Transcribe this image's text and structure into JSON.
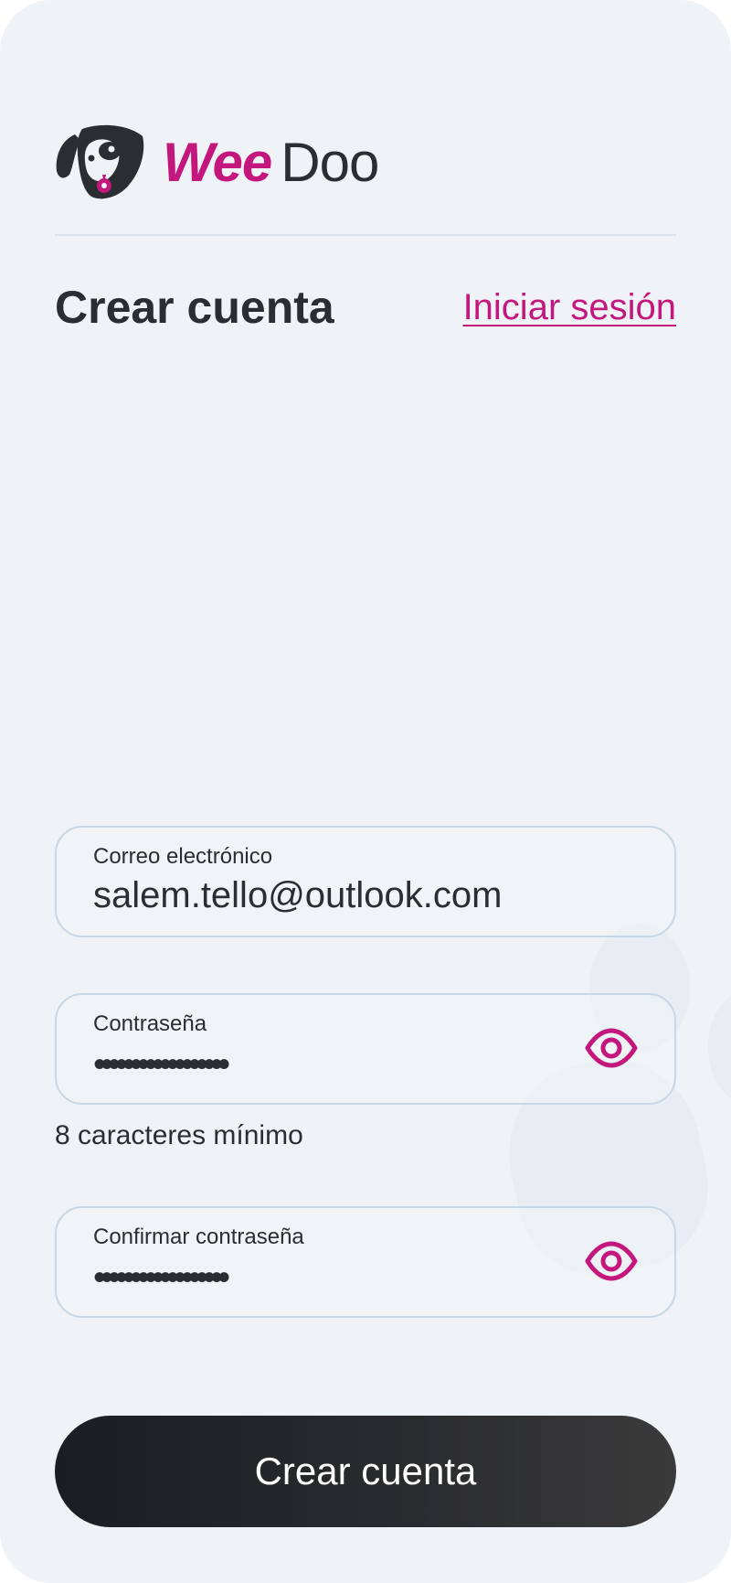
{
  "brand": {
    "name_part1": "Wee",
    "name_part2": "Doo",
    "accent_color": "#c4177d",
    "dark_color": "#2a2d32"
  },
  "header": {
    "title": "Crear cuenta",
    "login_link": "Iniciar sesión"
  },
  "form": {
    "email": {
      "label": "Correo electrónico",
      "value": "salem.tello@outlook.com"
    },
    "password": {
      "label": "Contraseña",
      "masked_value": "••••••••••••••••••",
      "toggle_icon": "eye-icon"
    },
    "password_hint": "8 caracteres mínimo",
    "confirm_password": {
      "label": "Confirmar contraseña",
      "masked_value": "••••••••••••••••••",
      "toggle_icon": "eye-icon"
    },
    "submit_label": "Crear cuenta"
  }
}
